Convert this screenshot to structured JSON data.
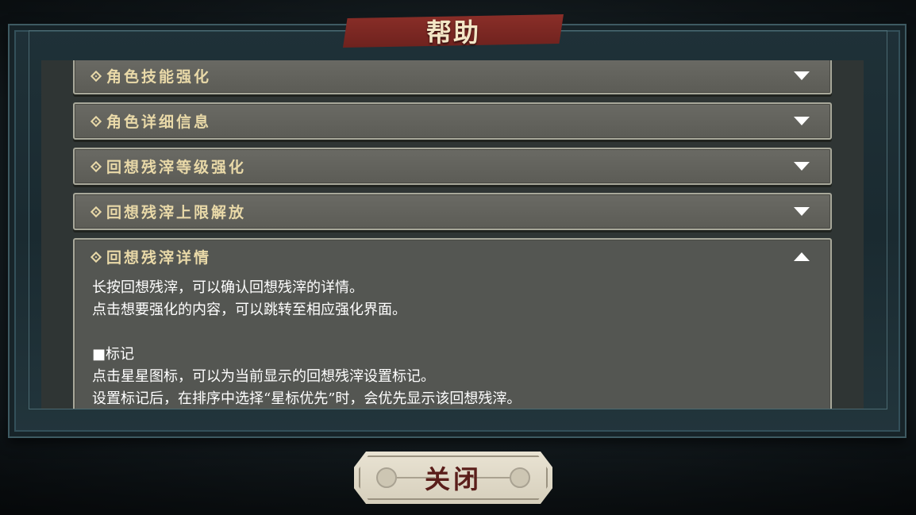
{
  "dialog": {
    "title": "帮助",
    "close_label": "关闭"
  },
  "items": [
    {
      "title": "角色技能强化",
      "expanded": false
    },
    {
      "title": "角色详细信息",
      "expanded": false
    },
    {
      "title": "回想残滓等级强化",
      "expanded": false
    },
    {
      "title": "回想残滓上限解放",
      "expanded": false
    },
    {
      "title": "回想残滓详情",
      "expanded": true,
      "body": [
        "长按回想残滓，可以确认回想残滓的详情。",
        "点击想要强化的内容，可以跳转至相应强化界面。",
        "",
        "■标记",
        "点击星星图标，可以为当前显示的回想残滓设置标记。",
        "设置标记后，在排序中选择“星标优先”时，会优先显示该回想残滓。"
      ]
    }
  ],
  "icons": {
    "bullet": "diamond-icon",
    "collapsed": "chevron-down-icon",
    "expanded": "chevron-up-icon"
  },
  "colors": {
    "title_banner": "#8a2e28",
    "item_title": "#e9d9a8",
    "close_text": "#5a1e1a"
  }
}
